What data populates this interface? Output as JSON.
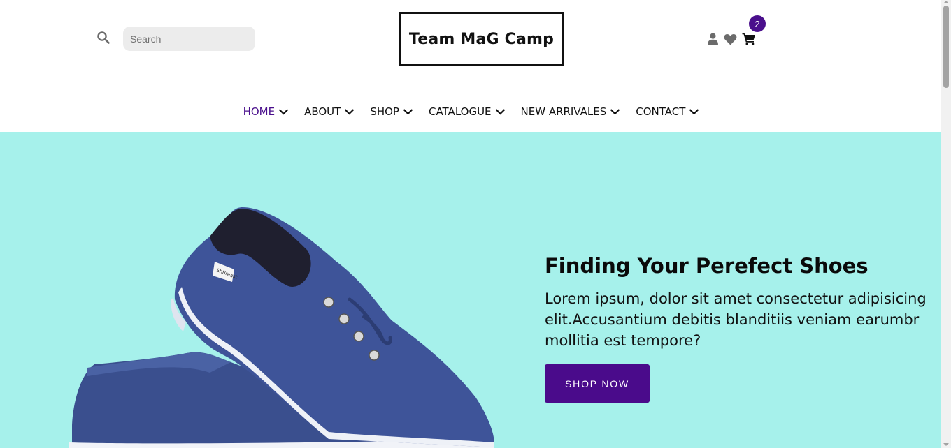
{
  "header": {
    "search": {
      "placeholder": "Search",
      "value": ""
    },
    "logo": "Team MaG Camp",
    "cart_count": "2",
    "icons": [
      "search-icon",
      "user-icon",
      "heart-icon",
      "cart-icon"
    ]
  },
  "nav": {
    "items": [
      {
        "label": "HOME",
        "active": true
      },
      {
        "label": "ABOUT",
        "active": false
      },
      {
        "label": "SHOP",
        "active": false
      },
      {
        "label": "CATALOGUE",
        "active": false
      },
      {
        "label": "NEW ARRIVALES",
        "active": false
      },
      {
        "label": "CONTACT",
        "active": false
      }
    ]
  },
  "hero": {
    "title": "Finding Your Perefect Shoes",
    "text": "Lorem ipsum, dolor sit amet consectetur adipisicing elit.Accusantium debitis blanditiis veniam earumbr mollitia est tempore?",
    "button": "SHOP NOW",
    "shoe_brand_tag": "ShBreast"
  },
  "colors": {
    "accent": "#4a0f8c",
    "hero_background": "#a6f1eb",
    "search_background": "#ececec",
    "icon_gray": "#6b6b6b"
  }
}
